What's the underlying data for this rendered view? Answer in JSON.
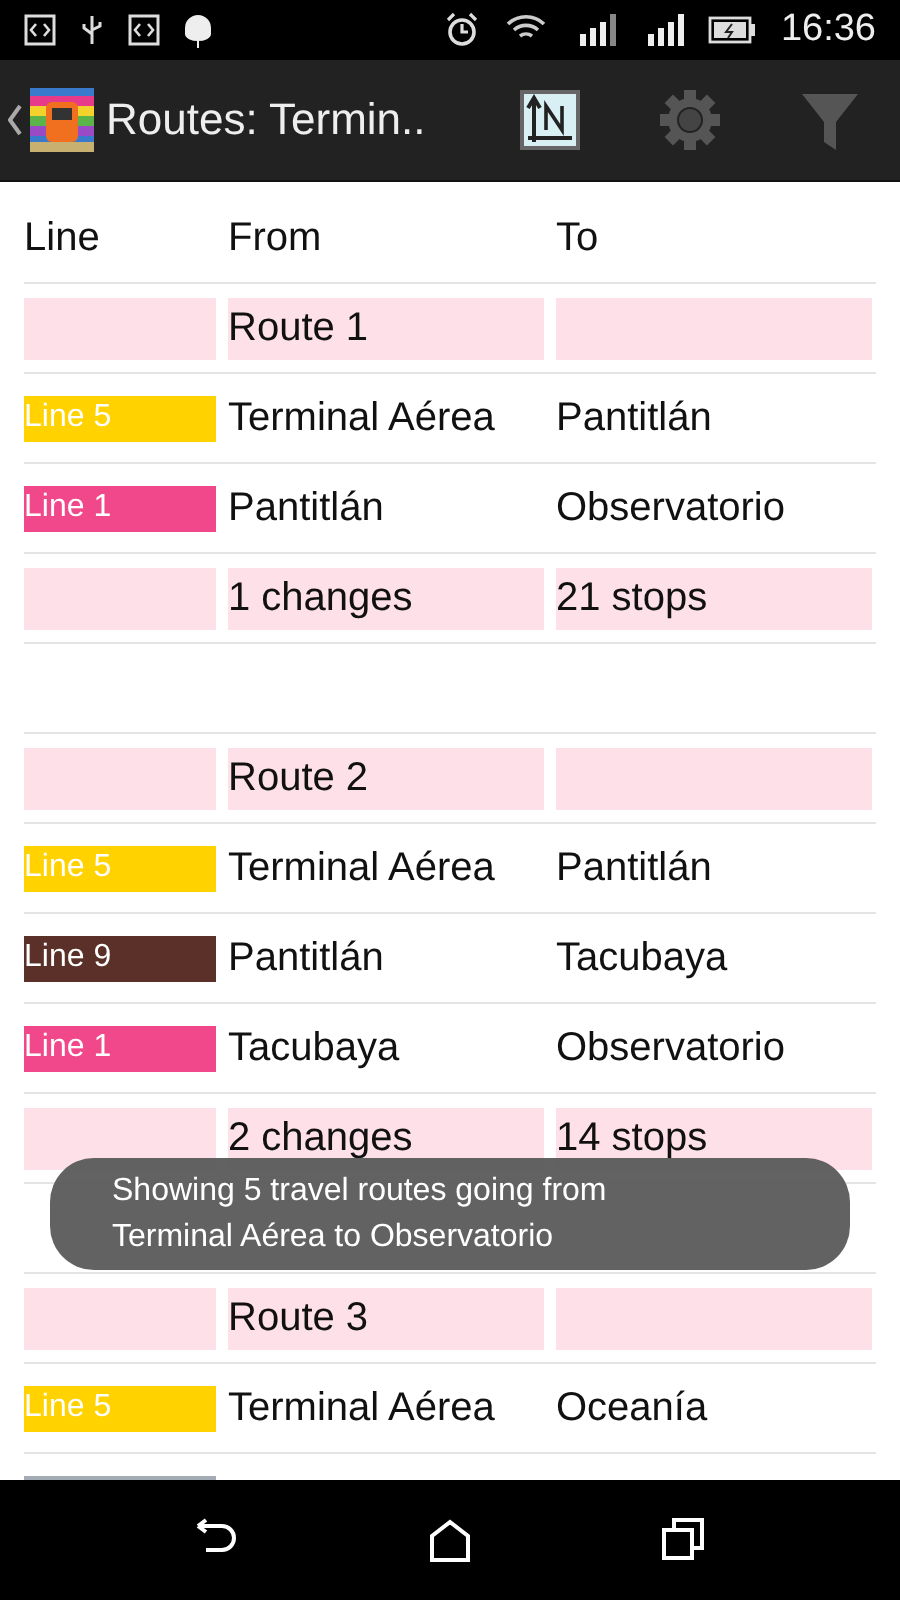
{
  "status_bar": {
    "time": "16:36"
  },
  "action_bar": {
    "title": "Routes: Termin.."
  },
  "table": {
    "columns": [
      "Line",
      "From",
      "To"
    ],
    "routes": [
      {
        "title": "Route 1",
        "legs": [
          {
            "line": "Line 5",
            "color": "#ffd200",
            "from": "Terminal Aérea",
            "to": "Pantitlán"
          },
          {
            "line": "Line 1",
            "color": "#f0488a",
            "from": "Pantitlán",
            "to": "Observatorio"
          }
        ],
        "summary": {
          "changes": "1 changes",
          "stops": "21 stops"
        }
      },
      {
        "title": "Route 2",
        "legs": [
          {
            "line": "Line 5",
            "color": "#ffd200",
            "from": "Terminal Aérea",
            "to": "Pantitlán"
          },
          {
            "line": "Line 9",
            "color": "#5a3028",
            "from": "Pantitlán",
            "to": "Tacubaya"
          },
          {
            "line": "Line 1",
            "color": "#f0488a",
            "from": "Tacubaya",
            "to": "Observatorio"
          }
        ],
        "summary": {
          "changes": "2 changes",
          "stops": "14 stops"
        }
      },
      {
        "title": "Route 3",
        "legs": [
          {
            "line": "Line 5",
            "color": "#ffd200",
            "from": "Terminal Aérea",
            "to": "Oceanía"
          },
          {
            "color": "#a3acb5"
          }
        ]
      }
    ]
  },
  "toast": {
    "text": "Showing 5 travel routes going from Terminal Aérea to Observatorio"
  }
}
